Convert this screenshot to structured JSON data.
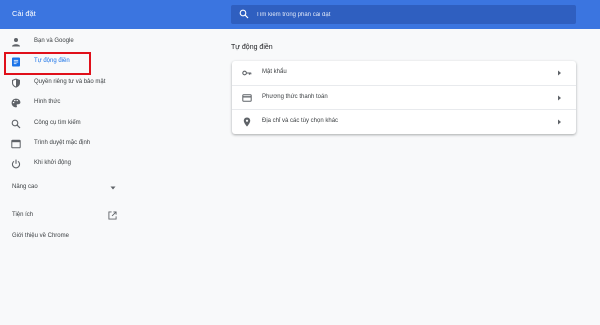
{
  "header": {
    "title": "Cài đặt",
    "search_placeholder": "Tìm kiếm trong phần cài đặt"
  },
  "sidebar": {
    "items": [
      {
        "label": "Bạn và Google",
        "icon": "person-icon"
      },
      {
        "label": "Tự động điền",
        "icon": "autofill-icon",
        "active": true
      },
      {
        "label": "Quyền riêng tư và bảo mật",
        "icon": "shield-icon"
      },
      {
        "label": "Hình thức",
        "icon": "palette-icon"
      },
      {
        "label": "Công cụ tìm kiếm",
        "icon": "search-icon"
      },
      {
        "label": "Trình duyệt mặc định",
        "icon": "browser-icon"
      },
      {
        "label": "Khi khởi động",
        "icon": "power-icon"
      }
    ],
    "advanced_label": "Nâng cao",
    "extensions_label": "Tiện ích",
    "about_label": "Giới thiệu về Chrome"
  },
  "main": {
    "section_title": "Tự động điền",
    "rows": [
      {
        "label": "Mật khẩu",
        "icon": "key-icon"
      },
      {
        "label": "Phương thức thanh toán",
        "icon": "credit-card-icon"
      },
      {
        "label": "Địa chỉ và các tùy chọn khác",
        "icon": "location-pin-icon"
      }
    ]
  },
  "colors": {
    "accent": "#1a73e8",
    "header_bg": "#3b75e0",
    "highlight": "#e0101a"
  }
}
